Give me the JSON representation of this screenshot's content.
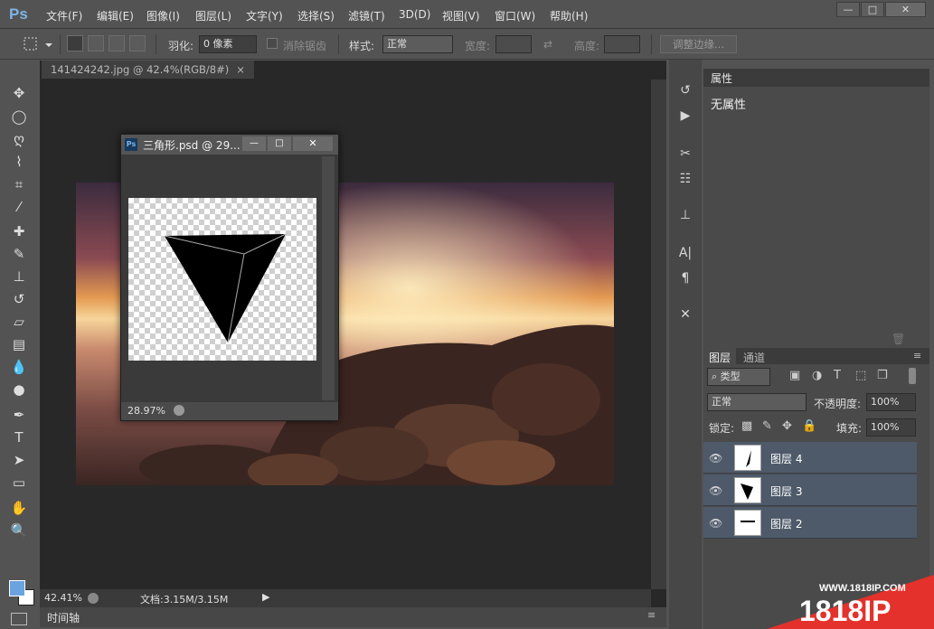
{
  "app": {
    "logo": "Ps"
  },
  "menu": [
    "文件(F)",
    "编辑(E)",
    "图像(I)",
    "图层(L)",
    "文字(Y)",
    "选择(S)",
    "滤镜(T)",
    "3D(D)",
    "视图(V)",
    "窗口(W)",
    "帮助(H)"
  ],
  "window_controls": {
    "minimize": "—",
    "restore": "□",
    "close": "✕"
  },
  "options": {
    "feather_label": "羽化:",
    "feather_value": "0 像素",
    "antialias_label": "消除锯齿",
    "style_label": "样式:",
    "style_value": "正常",
    "width_label": "宽度:",
    "height_label": "高度:",
    "refine_edge": "调整边缘..."
  },
  "document": {
    "tab_title": "141424242.jpg @ 42.4%(RGB/8#)",
    "tab_close": "×",
    "zoom": "42.41%",
    "doc_info": "文档:3.15M/3.15M"
  },
  "float_window": {
    "title": "三角形.psd @ 29...",
    "zoom": "28.97%"
  },
  "timeline_label": "时间轴",
  "properties": {
    "tab": "属性",
    "content": "无属性"
  },
  "layers_panel": {
    "tabs": [
      "图层",
      "通道"
    ],
    "filter_type": "类型",
    "blend_mode": "正常",
    "opacity_label": "不透明度:",
    "opacity_value": "100%",
    "lock_label": "锁定:",
    "fill_label": "填充:",
    "fill_value": "100%",
    "layers": [
      {
        "name": "图层 4"
      },
      {
        "name": "图层 3"
      },
      {
        "name": "图层 2"
      }
    ]
  },
  "watermark": {
    "url": "WWW.1818IP.COM",
    "brand": "1818IP"
  },
  "colors": {
    "accent": "#7fb4e6",
    "panel": "#535353",
    "layer_selected": "#4e5a6a",
    "watermark": "#e4312b"
  }
}
